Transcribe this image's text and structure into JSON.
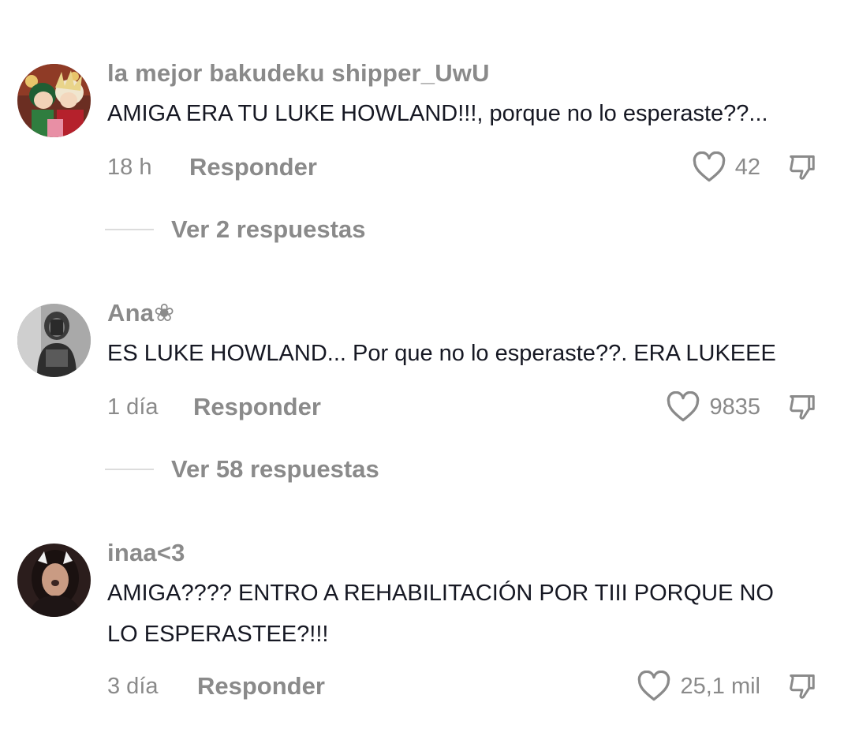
{
  "comments": [
    {
      "username": "la mejor bakudeku shipper_UwU",
      "text": "AMIGA ERA TU LUKE HOWLAND!!!, porque no lo esperaste??...",
      "time": "18 h",
      "reply_label": "Responder",
      "likes": "42",
      "view_replies": "Ver 2 respuestas"
    },
    {
      "username": "Ana❀",
      "text": "ES LUKE HOWLAND... Por que no lo esperaste??. ERA LUKEEE",
      "time": "1 día",
      "reply_label": "Responder",
      "likes": "9835",
      "view_replies": "Ver 58 respuestas"
    },
    {
      "username": "inaa<3",
      "text": "AMIGA???? ENTRO A REHABILITACIÓN POR TIII PORQUE NO\nLO ESPERASTEE?!!!",
      "time": "3 día",
      "reply_label": "Responder",
      "likes": "25,1 mil"
    }
  ],
  "icons": {
    "like": "heart-outline-icon",
    "dislike": "thumbs-down-icon"
  },
  "colors": {
    "text_primary": "#161823",
    "text_secondary": "#8a8a8a",
    "background": "#ffffff"
  }
}
